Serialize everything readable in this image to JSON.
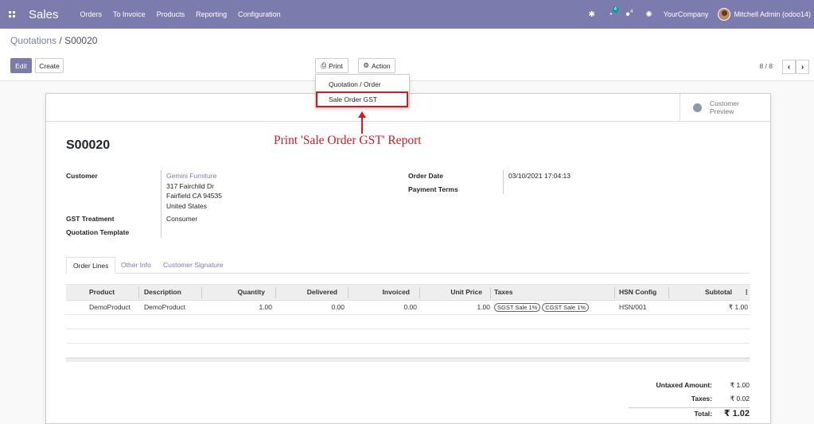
{
  "topbar": {
    "app_name": "Sales",
    "menu": [
      "Orders",
      "To Invoice",
      "Products",
      "Reporting",
      "Configuration"
    ],
    "activity_badge": "4",
    "messages_count": "4",
    "company": "YourCompany",
    "user": "Mitchell Admin (odoo14)"
  },
  "breadcrumb": {
    "parent": "Quotations",
    "separator": "/",
    "current": "S00020"
  },
  "buttons": {
    "edit": "Edit",
    "create": "Create",
    "print": "Print",
    "action": "Action"
  },
  "pager": {
    "value": "8 / 8"
  },
  "print_menu": {
    "items": [
      "Quotation / Order",
      "Sale Order GST"
    ]
  },
  "annotation": "Print 'Sale Order GST' Report",
  "preview": {
    "line1": "Customer",
    "line2": "Preview"
  },
  "order": {
    "name": "S00020",
    "customer_label": "Customer",
    "customer_name": "Gemini Furniture",
    "address1": "317 Fairchild Dr",
    "address2": "Fairfield CA 94535",
    "address3": "United States",
    "gst_label": "GST Treatment",
    "gst_value": "Consumer",
    "template_label": "Quotation Template",
    "date_label": "Order Date",
    "date_value": "03/10/2021 17:04:13",
    "terms_label": "Payment Terms"
  },
  "tabs": [
    "Order Lines",
    "Other Info",
    "Customer Signature"
  ],
  "table": {
    "columns": [
      "Product",
      "Description",
      "Quantity",
      "Delivered",
      "Invoiced",
      "Unit Price",
      "Taxes",
      "HSN Config",
      "Subtotal"
    ],
    "rows": [
      {
        "product": "DemoProduct",
        "description": "DemoProduct",
        "quantity": "1.00",
        "delivered": "0.00",
        "invoiced": "0.00",
        "unit_price": "1.00",
        "taxes": [
          "SGST Sale 1%",
          "CGST Sale 1%"
        ],
        "hsn": "HSN/001",
        "subtotal": "₹ 1.00"
      }
    ]
  },
  "totals": {
    "untaxed_label": "Untaxed Amount:",
    "untaxed_value": "₹ 1.00",
    "taxes_label": "Taxes:",
    "taxes_value": "₹ 0.02",
    "total_label": "Total:",
    "total_value": "₹ 1.02"
  },
  "colors": {
    "brand": "#7c7bad",
    "annotation": "#d71920"
  }
}
